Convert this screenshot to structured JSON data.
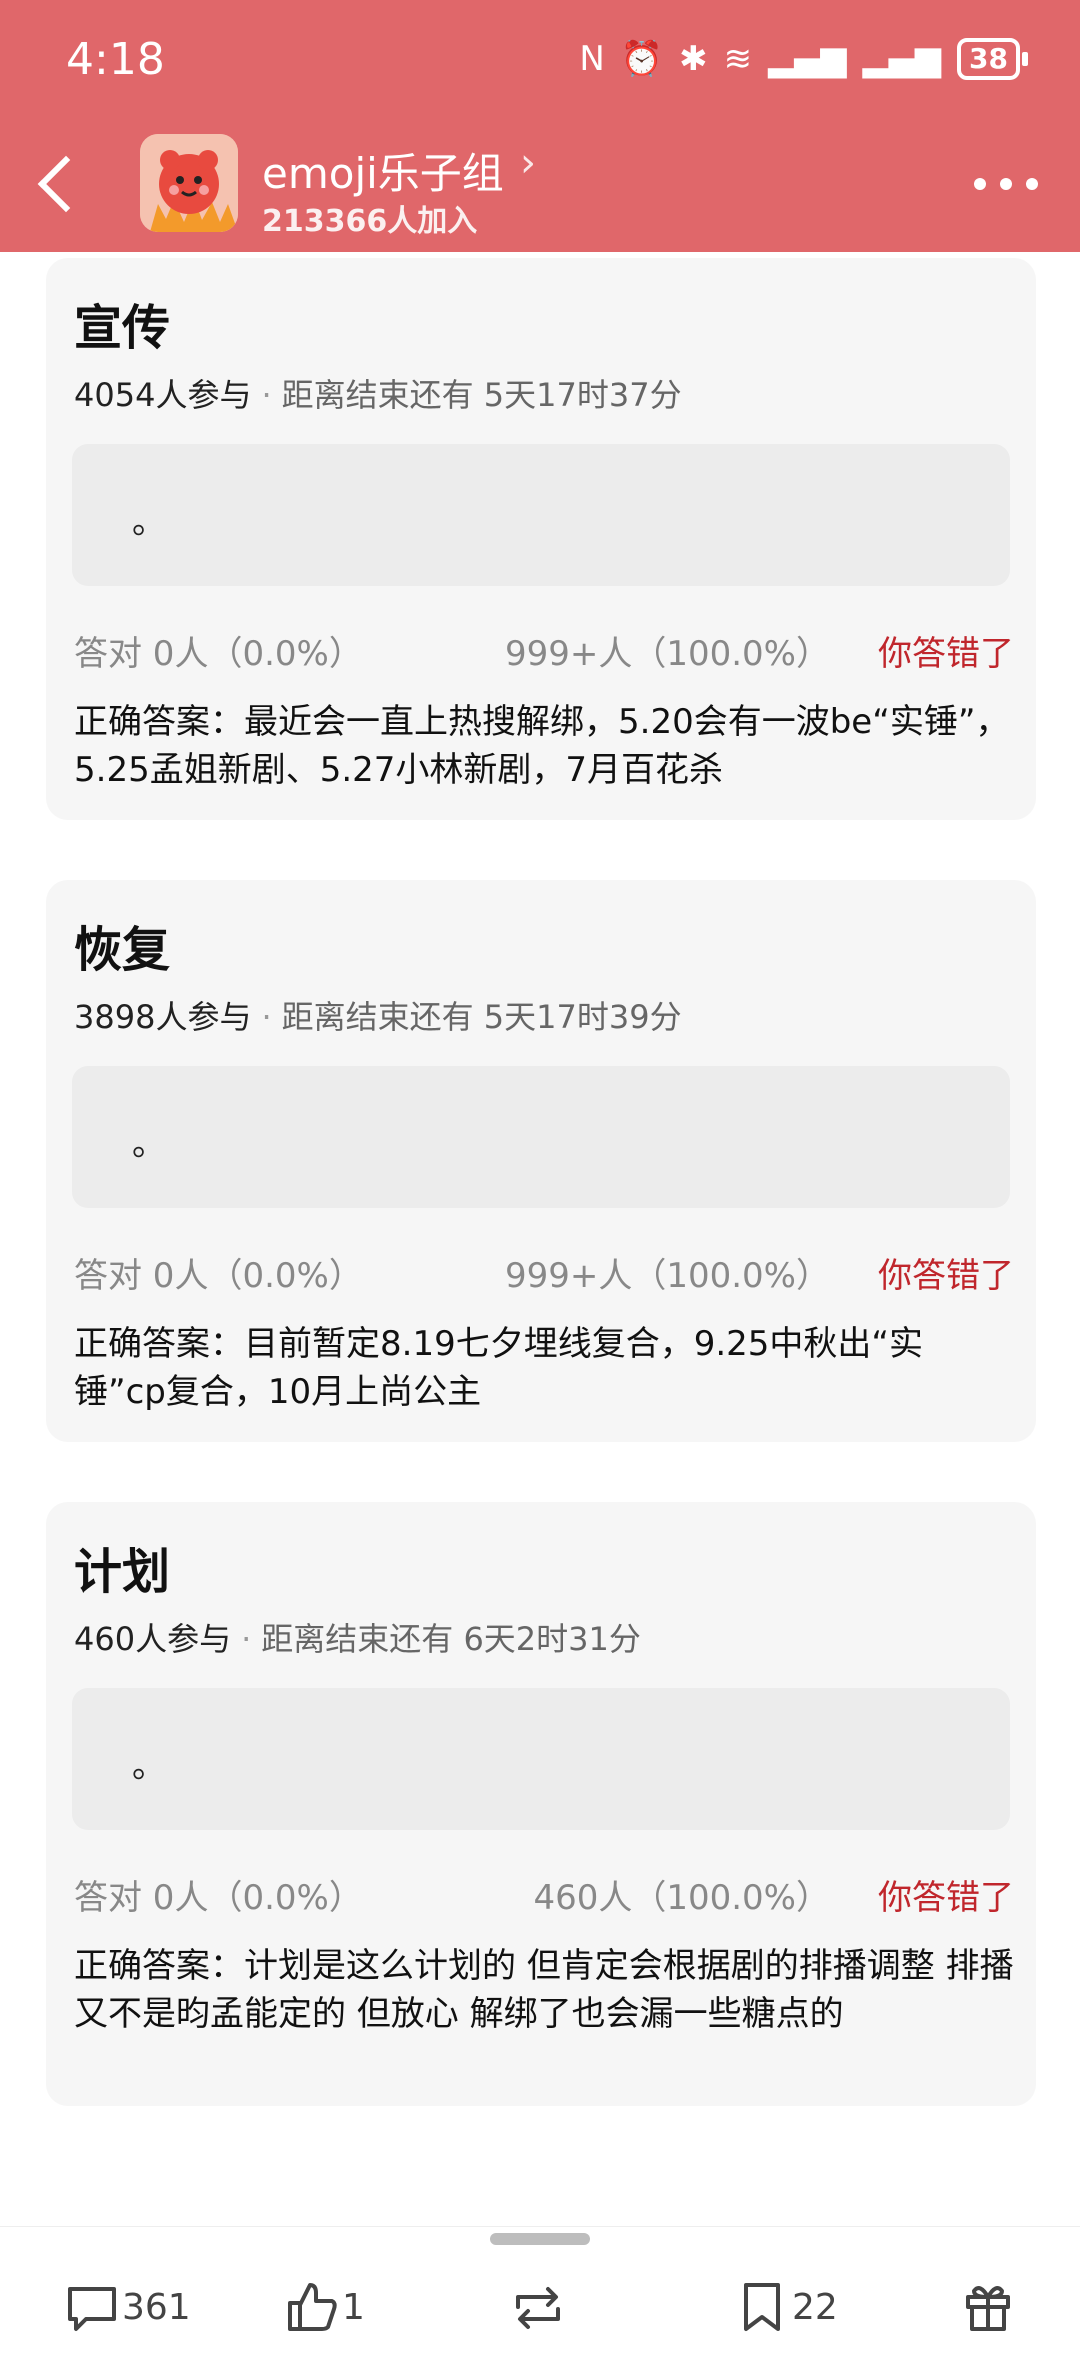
{
  "status_bar": {
    "time": "4:18",
    "battery": "38"
  },
  "header": {
    "group_name": "emoji乐子组",
    "chevron": "›",
    "members": "213366人加入"
  },
  "cards": [
    {
      "title": "宣传",
      "participants": "4054人参与",
      "separator": "·",
      "remaining": "距离结束还有 5天17时37分",
      "option": "。",
      "correct_stat": "答对  0人（0.0%）",
      "other_stat": "999+人（100.0%）",
      "result": "你答错了",
      "answer": "正确答案：最近会一直上热搜解绑，5.20会有一波be“实锤”，5.25孟姐新剧、5.27小林新剧，7月百花杀"
    },
    {
      "title": "恢复",
      "participants": "3898人参与",
      "separator": "·",
      "remaining": "距离结束还有 5天17时39分",
      "option": "。",
      "correct_stat": "答对  0人（0.0%）",
      "other_stat": "999+人（100.0%）",
      "result": "你答错了",
      "answer": "正确答案：目前暂定8.19七夕埋线复合，9.25中秋出“实锤”cp复合，10月上尚公主"
    },
    {
      "title": "计划",
      "participants": "460人参与",
      "separator": "·",
      "remaining": "距离结束还有 6天2时31分",
      "option": "。",
      "correct_stat": "答对  0人（0.0%）",
      "other_stat": "460人（100.0%）",
      "result": "你答错了",
      "answer": "正确答案：计划是这么计划的 但肯定会根据剧的排播调整 排播又不是昀孟能定的 但放心 解绑了也会漏一些糖点的"
    }
  ],
  "bottom_bar": {
    "comments": "361",
    "likes": "1",
    "reposts": "",
    "bookmarks": "22"
  }
}
